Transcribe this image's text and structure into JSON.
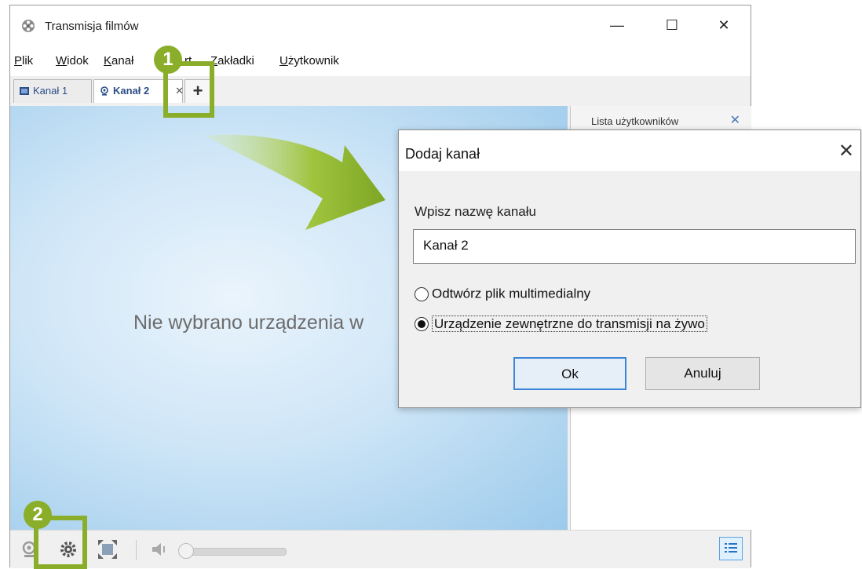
{
  "window": {
    "title": "Transmisja filmów",
    "controls": {
      "minimize": "—",
      "maximize": "☐",
      "close": "✕"
    }
  },
  "menubar": {
    "items": [
      {
        "label": "Plik"
      },
      {
        "label": "Widok"
      },
      {
        "label": "Kanał"
      },
      {
        "label": "rt"
      },
      {
        "label": "Zakładki"
      },
      {
        "label": "Użytkownik"
      }
    ]
  },
  "tabs": [
    {
      "label": "Kanał 1",
      "icon": "film-icon"
    },
    {
      "label": "Kanał 2",
      "icon": "webcam-icon",
      "close": "✕"
    },
    {
      "label": "+",
      "icon": "add-tab-icon"
    }
  ],
  "video": {
    "message": "Nie wybrano urządzenia w"
  },
  "user_panel": {
    "title": "Lista użytkowników",
    "close": "✕"
  },
  "toolbar": {
    "icons": [
      "webcam-icon",
      "settings-icon",
      "fullscreen-icon",
      "volume-icon",
      "volume-slider",
      "user-list-icon"
    ],
    "volume_level": 0
  },
  "annotations": {
    "badge1": "1",
    "badge2": "2",
    "highlight_color": "#8aae2a"
  },
  "dialog": {
    "title": "Dodaj kanał",
    "close": "✕",
    "label": "Wpisz nazwę kanału",
    "input_value": "Kanał 2",
    "options": [
      {
        "label": "Odtwórz plik multimedialny",
        "selected": false
      },
      {
        "label": "Urządzenie zewnętrzne do transmisji na żywo",
        "selected": true
      }
    ],
    "ok": "Ok",
    "cancel": "Anuluj"
  }
}
